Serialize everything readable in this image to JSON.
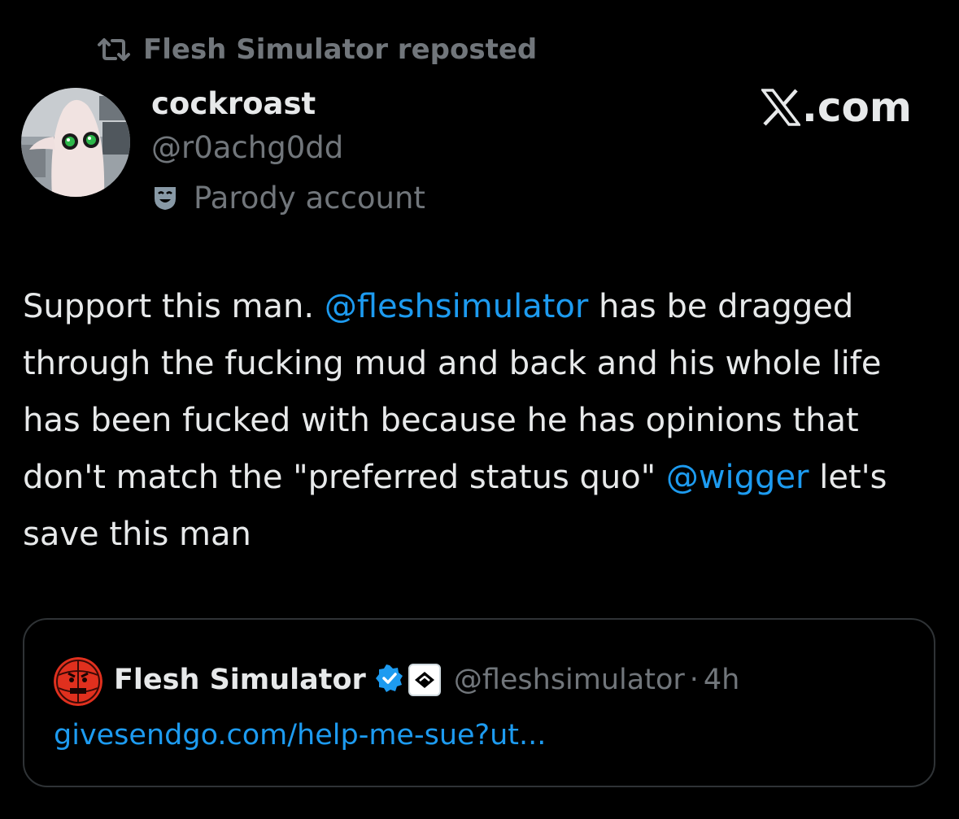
{
  "repost": {
    "icon": "repost-icon",
    "text": "Flesh Simulator reposted"
  },
  "author": {
    "display_name": "cockroast",
    "handle": "@r0achg0dd",
    "parody_icon": "theater-mask-icon",
    "parody_label": "Parody account"
  },
  "brand": {
    "icon": "x-logo-icon",
    "suffix": ".com"
  },
  "tweet": {
    "segments": [
      {
        "text": "Support this man. ",
        "type": "text"
      },
      {
        "text": "@fleshsimulator",
        "type": "mention"
      },
      {
        "text": " has be dragged through the fucking mud and back and his whole life has been fucked with because he has opinions that don't match the \"preferred status quo\" ",
        "type": "text"
      },
      {
        "text": "@wigger",
        "type": "mention"
      },
      {
        "text": " let's save this man",
        "type": "text"
      }
    ]
  },
  "quote": {
    "display_name": "Flesh Simulator",
    "verified_icon": "verified-badge-icon",
    "affiliate_icon": "affiliate-badge-icon",
    "handle": "@fleshsimulator",
    "separator": "·",
    "time": "4h",
    "link_text": "givesendgo.com/help-me-sue?ut..."
  },
  "colors": {
    "background": "#000000",
    "text_primary": "#e7e9ea",
    "text_secondary": "#71767b",
    "link": "#1d9bf0",
    "border": "#2f3336"
  }
}
